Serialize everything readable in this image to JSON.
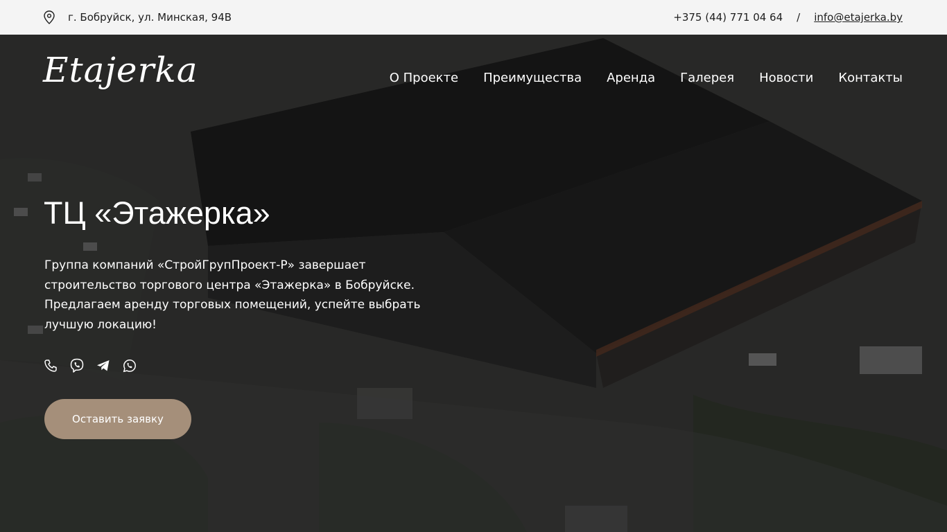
{
  "topbar": {
    "address_icon": "map-pin-icon",
    "address": "г. Бобруйск, ул. Минская, 94В",
    "phone": "+375 (44) 771 04 64",
    "separator": "/",
    "email": "info@etajerka.by"
  },
  "header": {
    "logo": "Etajerka",
    "nav": [
      "О Проекте",
      "Преимущества",
      "Аренда",
      "Галерея",
      "Новости",
      "Контакты"
    ]
  },
  "hero": {
    "title": "ТЦ «Этажерка»",
    "text": "Группа компаний «СтройГрупПроект-Р» завершает строительство торгового центра «Этажерка» в Бобруйске. Предлагаем аренду торговых помещений, успейте выбрать лучшую локацию!",
    "socials": [
      "phone-icon",
      "viber-icon",
      "telegram-icon",
      "whatsapp-icon"
    ],
    "cta_label": "Оставить заявку"
  },
  "colors": {
    "topbar_bg": "#f4f4f4",
    "hero_overlay": "#1a1a1a",
    "cta_bg": "#a58f7a",
    "text_light": "#ffffff"
  }
}
